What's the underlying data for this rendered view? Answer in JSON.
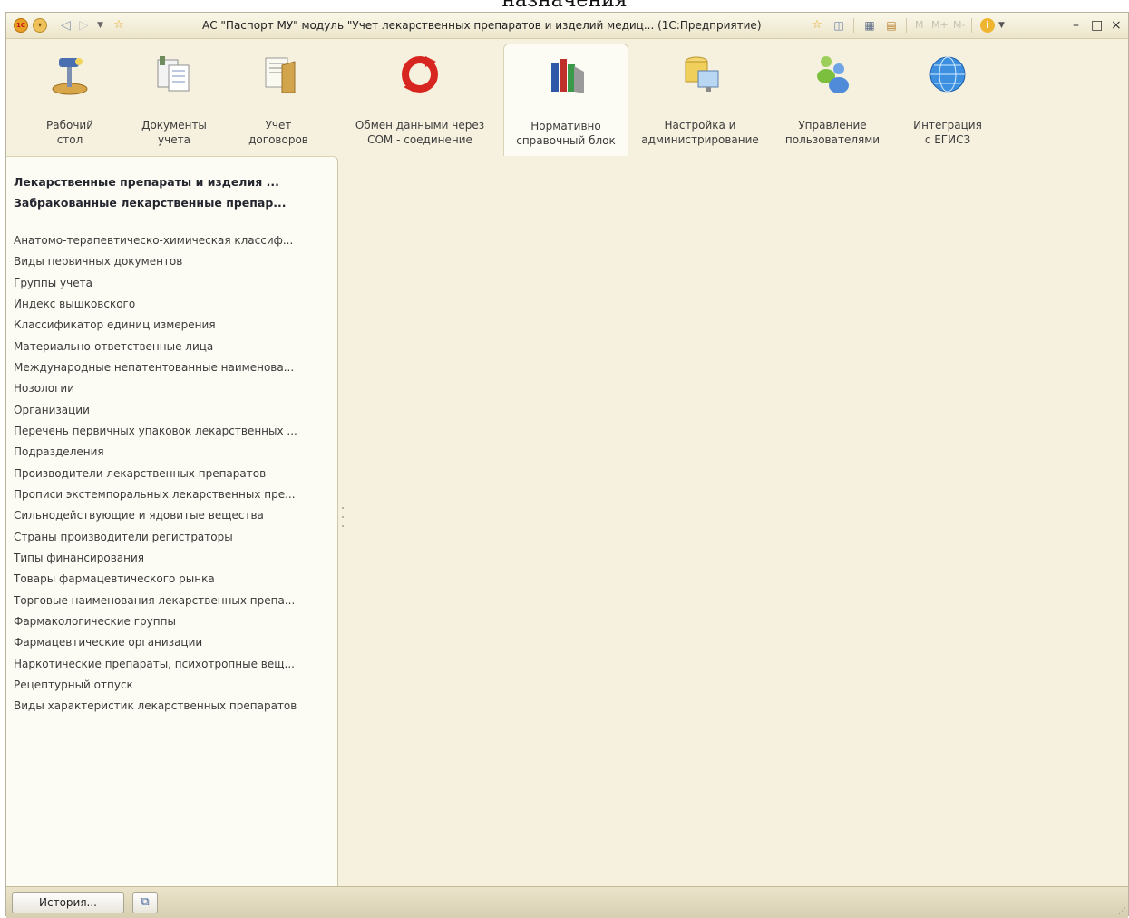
{
  "page_caption": "назначения",
  "window": {
    "title": "АС \"Паспорт МУ\" модуль \"Учет лекарственных препаратов и изделий медиц... (1С:Предприятие)",
    "memory_buttons": [
      "M",
      "M+",
      "M-"
    ]
  },
  "sections": [
    {
      "label": "Рабочий\nстол",
      "icon": "desk-lamp-icon"
    },
    {
      "label": "Документы\nучета",
      "icon": "documents-icon"
    },
    {
      "label": "Учет\nдоговоров",
      "icon": "contracts-folder-icon"
    },
    {
      "label": "Обмен данными через\nCOM - соединение",
      "icon": "exchange-arrows-icon"
    },
    {
      "label": "Нормативно\nсправочный блок",
      "icon": "books-icon",
      "active": true
    },
    {
      "label": "Настройка и\nадминистрирование",
      "icon": "database-monitor-icon"
    },
    {
      "label": "Управление\nпользователями",
      "icon": "users-icon"
    },
    {
      "label": "Интеграция\nс ЕГИСЗ",
      "icon": "globe-icon"
    }
  ],
  "nav_panel": {
    "bold_links": [
      "Лекарственные препараты и изделия ...",
      "Забракованные лекарственные препар..."
    ],
    "items": [
      "Анатомо-терапевтическо-химическая классиф...",
      "Виды первичных документов",
      "Группы учета",
      "Индекс вышковского",
      "Классификатор единиц измерения",
      "Материально-ответственные лица",
      "Международные непатентованные наименова...",
      "Нозологии",
      "Организации",
      "Перечень первичных упаковок лекарственных ...",
      "Подразделения",
      "Производители лекарственных препаратов",
      "Прописи экстемпоральных лекарственных пре...",
      "Сильнодействующие и ядовитые вещества",
      "Страны производители регистраторы",
      "Типы финансирования",
      "Товары фармацевтического рынка",
      "Торговые наименования лекарственных препа...",
      "Фармакологические группы",
      "Фармацевтические организации",
      "Наркотические препараты, психотропные вещ...",
      "Рецептурный отпуск",
      "Виды характеристик лекарственных препаратов"
    ]
  },
  "statusbar": {
    "history_label": "История..."
  }
}
